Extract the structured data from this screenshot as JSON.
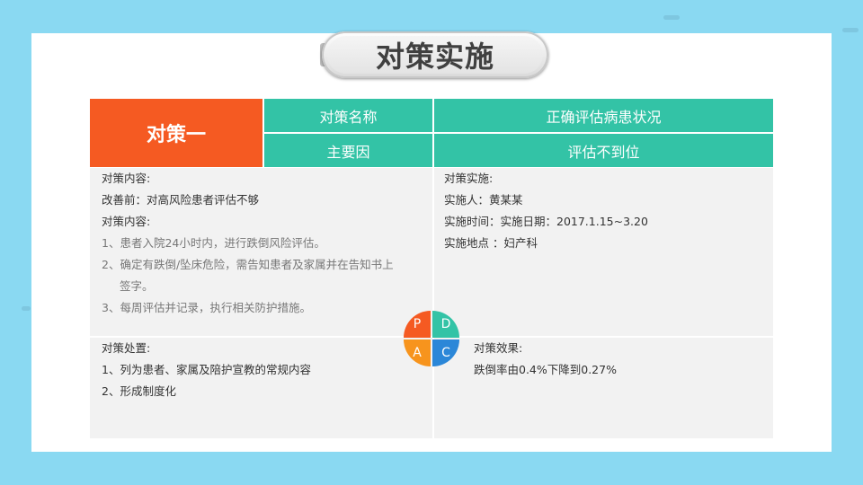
{
  "title": "对策实施",
  "header": {
    "badge": "对策一",
    "label1": "对策名称",
    "value1": "正确评估病患状况",
    "label2": "主要因",
    "value2": "评估不到位"
  },
  "plan": {
    "heading": "对策内容:",
    "before": "改善前：对高风险患者评估不够",
    "content_heading": "对策内容:",
    "items": [
      "1、患者入院24小时内，进行跌倒风险评估。",
      "2、确定有跌倒/坠床危险，需告知患者及家属并在告知书上",
      "签字。",
      "3、每周评估并记录，执行相关防护措施。"
    ]
  },
  "do": {
    "heading": "对策实施:",
    "person": "实施人：黄某某",
    "time": "实施时间：实施日期：2017.1.15~3.20",
    "place": "实施地点 ：妇产科"
  },
  "act": {
    "heading": "对策处置:",
    "items": [
      "1、列为患者、家属及陪护宣教的常规内容",
      "2、形成制度化"
    ]
  },
  "check": {
    "heading": "对策效果:",
    "result": "跌倒率由0.4%下降到0.27%"
  },
  "pdca": {
    "p": "P",
    "d": "D",
    "a": "A",
    "c": "C"
  },
  "colors": {
    "background": "#8ad9f2",
    "orange": "#f55a22",
    "teal": "#33c3a6",
    "amber": "#f7941d",
    "blue": "#2b87d8",
    "panel": "#f2f2f2"
  }
}
